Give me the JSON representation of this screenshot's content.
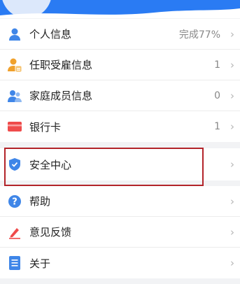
{
  "groups": [
    {
      "items": [
        {
          "icon": "person-icon",
          "label": "个人信息",
          "value": "完成77%"
        },
        {
          "icon": "employee-badge-icon",
          "label": "任职受雇信息",
          "value": "1"
        },
        {
          "icon": "family-members-icon",
          "label": "家庭成员信息",
          "value": "0"
        },
        {
          "icon": "bank-card-icon",
          "label": "银行卡",
          "value": "1"
        }
      ]
    },
    {
      "items": [
        {
          "icon": "shield-icon",
          "label": "安全中心",
          "value": ""
        }
      ]
    },
    {
      "items": [
        {
          "icon": "help-icon",
          "label": "帮助",
          "value": ""
        },
        {
          "icon": "feedback-pen-icon",
          "label": "意见反馈",
          "value": ""
        },
        {
          "icon": "about-document-icon",
          "label": "关于",
          "value": ""
        }
      ]
    }
  ],
  "colors": {
    "header_blue": "#2a7bf3",
    "highlight_red": "#b3242a",
    "icon_blue": "#3f86e8",
    "icon_orange": "#f0a12c",
    "icon_red": "#ef4b4b"
  }
}
